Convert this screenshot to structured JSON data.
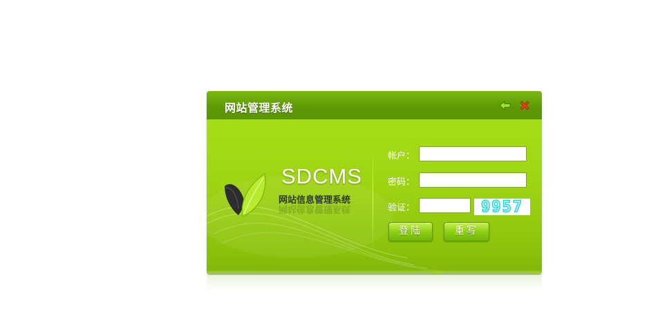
{
  "window": {
    "title": "网站管理系统"
  },
  "titlebar_icons": {
    "back": "back-arrow-icon",
    "close": "close-x-icon"
  },
  "logo": {
    "name": "SDCMS",
    "subtitle": "网站信息管理系统"
  },
  "form": {
    "account_label": "帐户：",
    "account_value": "",
    "password_label": "密码：",
    "password_value": "",
    "captcha_label": "验证：",
    "captcha_value": "",
    "captcha_code": "9957"
  },
  "buttons": {
    "login": "登陆",
    "reset": "重写"
  },
  "colors": {
    "header": "#5f9a06",
    "body": "#9ed313",
    "captcha_digits": "#19d8e8"
  }
}
